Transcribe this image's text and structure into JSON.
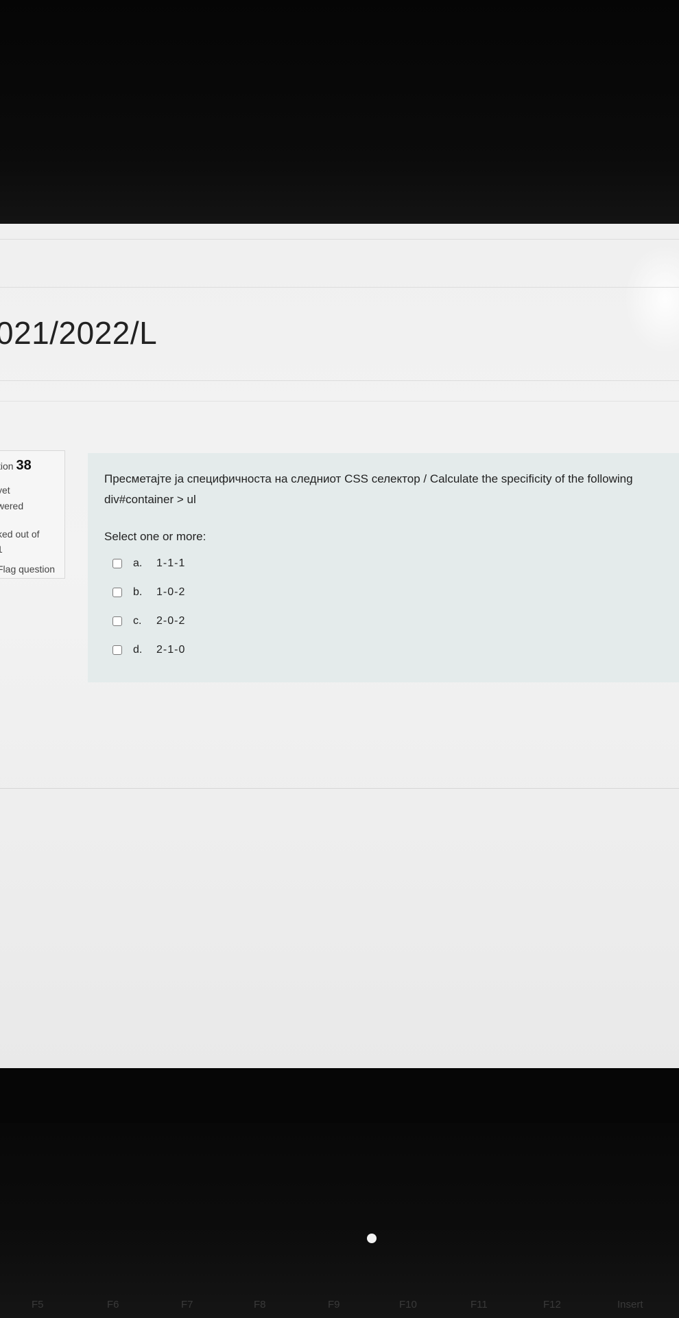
{
  "header": {
    "course_title": "021/2022/L"
  },
  "question_info": {
    "label": "stion",
    "number": "38",
    "state_line1": "yet",
    "state_line2": "wered",
    "grade_line1": "ked out of",
    "grade_line2": "1",
    "flag_label": "Flag question"
  },
  "question": {
    "text": "Пресметајте ја специфичноста на следниот CSS селектор / Calculate the specificity of the following",
    "selector": "div#container > ul",
    "prompt": "Select one or more:",
    "answers": [
      {
        "letter": "a.",
        "value": "1-1-1",
        "checked": false
      },
      {
        "letter": "b.",
        "value": "1-0-2",
        "checked": false
      },
      {
        "letter": "c.",
        "value": "2-0-2",
        "checked": false
      },
      {
        "letter": "d.",
        "value": "2-1-0",
        "checked": false
      }
    ]
  },
  "keyboard": {
    "keys": [
      "F5",
      "F6",
      "F7",
      "F8",
      "F9",
      "F10",
      "F11",
      "F12",
      "Insert"
    ]
  }
}
